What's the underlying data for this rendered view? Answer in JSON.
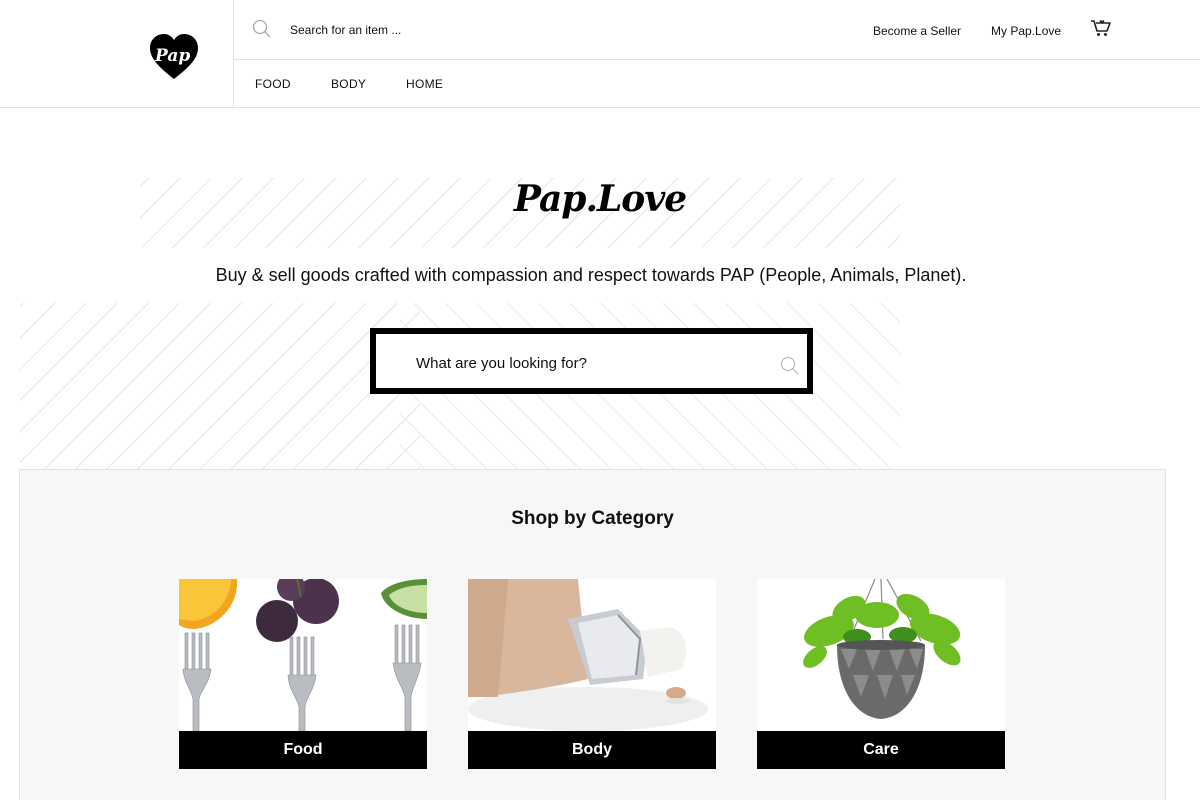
{
  "header": {
    "logo_text": "Pap",
    "search_placeholder": "Search for an item ...",
    "links": {
      "become_seller": "Become a Seller",
      "my_account": "My Pap.Love"
    },
    "nav": [
      "FOOD",
      "BODY",
      "HOME"
    ]
  },
  "hero": {
    "title": "Pap.Love",
    "tagline": "Buy & sell goods crafted with compassion and respect towards PAP (People, Animals, Planet).",
    "search_placeholder": "What are you looking for?"
  },
  "categories": {
    "title": "Shop by Category",
    "items": [
      {
        "label": "Food"
      },
      {
        "label": "Body"
      },
      {
        "label": "Care"
      }
    ]
  },
  "colors": {
    "brand": "#000000",
    "border": "#e2e2e2",
    "panel_bg": "#f7f7f7"
  },
  "icons": [
    "heart-logo-icon",
    "search-icon",
    "cart-icon"
  ]
}
